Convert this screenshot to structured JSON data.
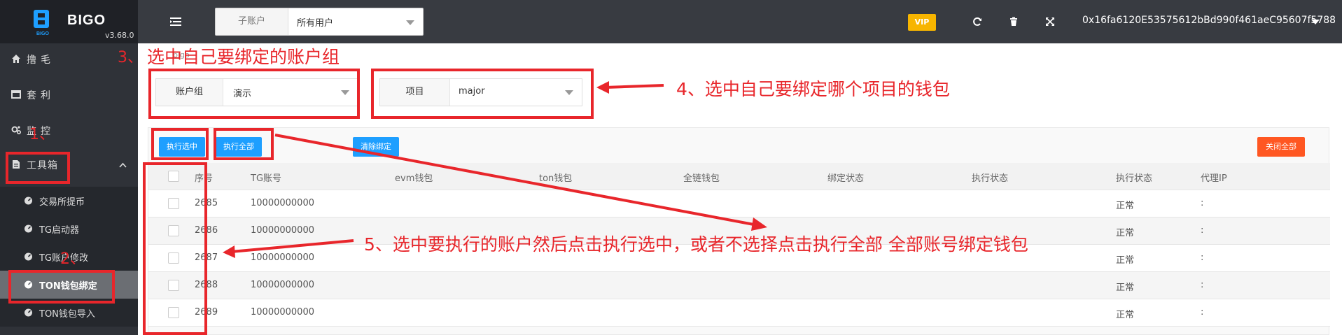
{
  "brand": {
    "name": "BIGO",
    "version": "v3.68.0",
    "logo_text": "BIGO"
  },
  "sidebar": {
    "items": [
      {
        "label": "撸毛",
        "icon": "home-icon"
      },
      {
        "label": "套利",
        "icon": "window-icon"
      },
      {
        "label": "监控",
        "icon": "gears-icon"
      },
      {
        "label": "工具箱",
        "icon": "file-icon"
      }
    ],
    "sub_items": [
      {
        "label": "交易所提币",
        "icon": "dashboard-icon"
      },
      {
        "label": "TG启动器",
        "icon": "dashboard-icon"
      },
      {
        "label": "TG账户修改",
        "icon": "dashboard-icon"
      },
      {
        "label": "TON钱包绑定",
        "icon": "dashboard-icon",
        "active": true
      },
      {
        "label": "TON钱包导入",
        "icon": "dashboard-icon"
      }
    ]
  },
  "header": {
    "sub_account_label": "子账户",
    "sub_account_value": "所有用户",
    "vip": "VIP",
    "wallet_address": "0x16fa6120E53575612bBd990f461aeC95607f5788"
  },
  "breadcrumb": "bigo",
  "filters": {
    "group_label": "账户组",
    "group_value": "演示",
    "project_label": "项目",
    "project_value": "major"
  },
  "toolbar": {
    "execute_selected": "执行选中",
    "execute_all": "执行全部",
    "clear_binding": "清除绑定",
    "close_all": "关闭全部"
  },
  "table": {
    "columns": [
      "序号",
      "TG账号",
      "evm钱包",
      "ton钱包",
      "全链钱包",
      "绑定状态",
      "执行状态",
      "执行状态",
      "代理IP"
    ],
    "rows": [
      {
        "id": "2685",
        "tg": "10000000000",
        "status": "正常",
        "proxy": ":"
      },
      {
        "id": "2686",
        "tg": "10000000000",
        "status": "正常",
        "proxy": ":"
      },
      {
        "id": "2687",
        "tg": "10000000000",
        "status": "正常",
        "proxy": ":"
      },
      {
        "id": "2688",
        "tg": "10000000000",
        "status": "正常",
        "proxy": ":"
      },
      {
        "id": "2689",
        "tg": "10000000000",
        "status": "正常",
        "proxy": ":"
      }
    ]
  },
  "annotations": {
    "step1": "1、",
    "step2": "2、",
    "step3": "3、",
    "step3_text": "选中自己要绑定的账户组",
    "step4": "4、选中自己要绑定哪个项目的钱包",
    "step5": "5、选中要执行的账户然后点击执行选中，或者不选择点击执行全部 全部账号绑定钱包"
  },
  "colors": {
    "sidebar_bg": "#2f3238",
    "header_bg": "#383b41",
    "accent_blue": "#1e9fff",
    "accent_orange": "#ff5722",
    "vip": "#f7b500",
    "annotation_red": "#e8262b"
  }
}
